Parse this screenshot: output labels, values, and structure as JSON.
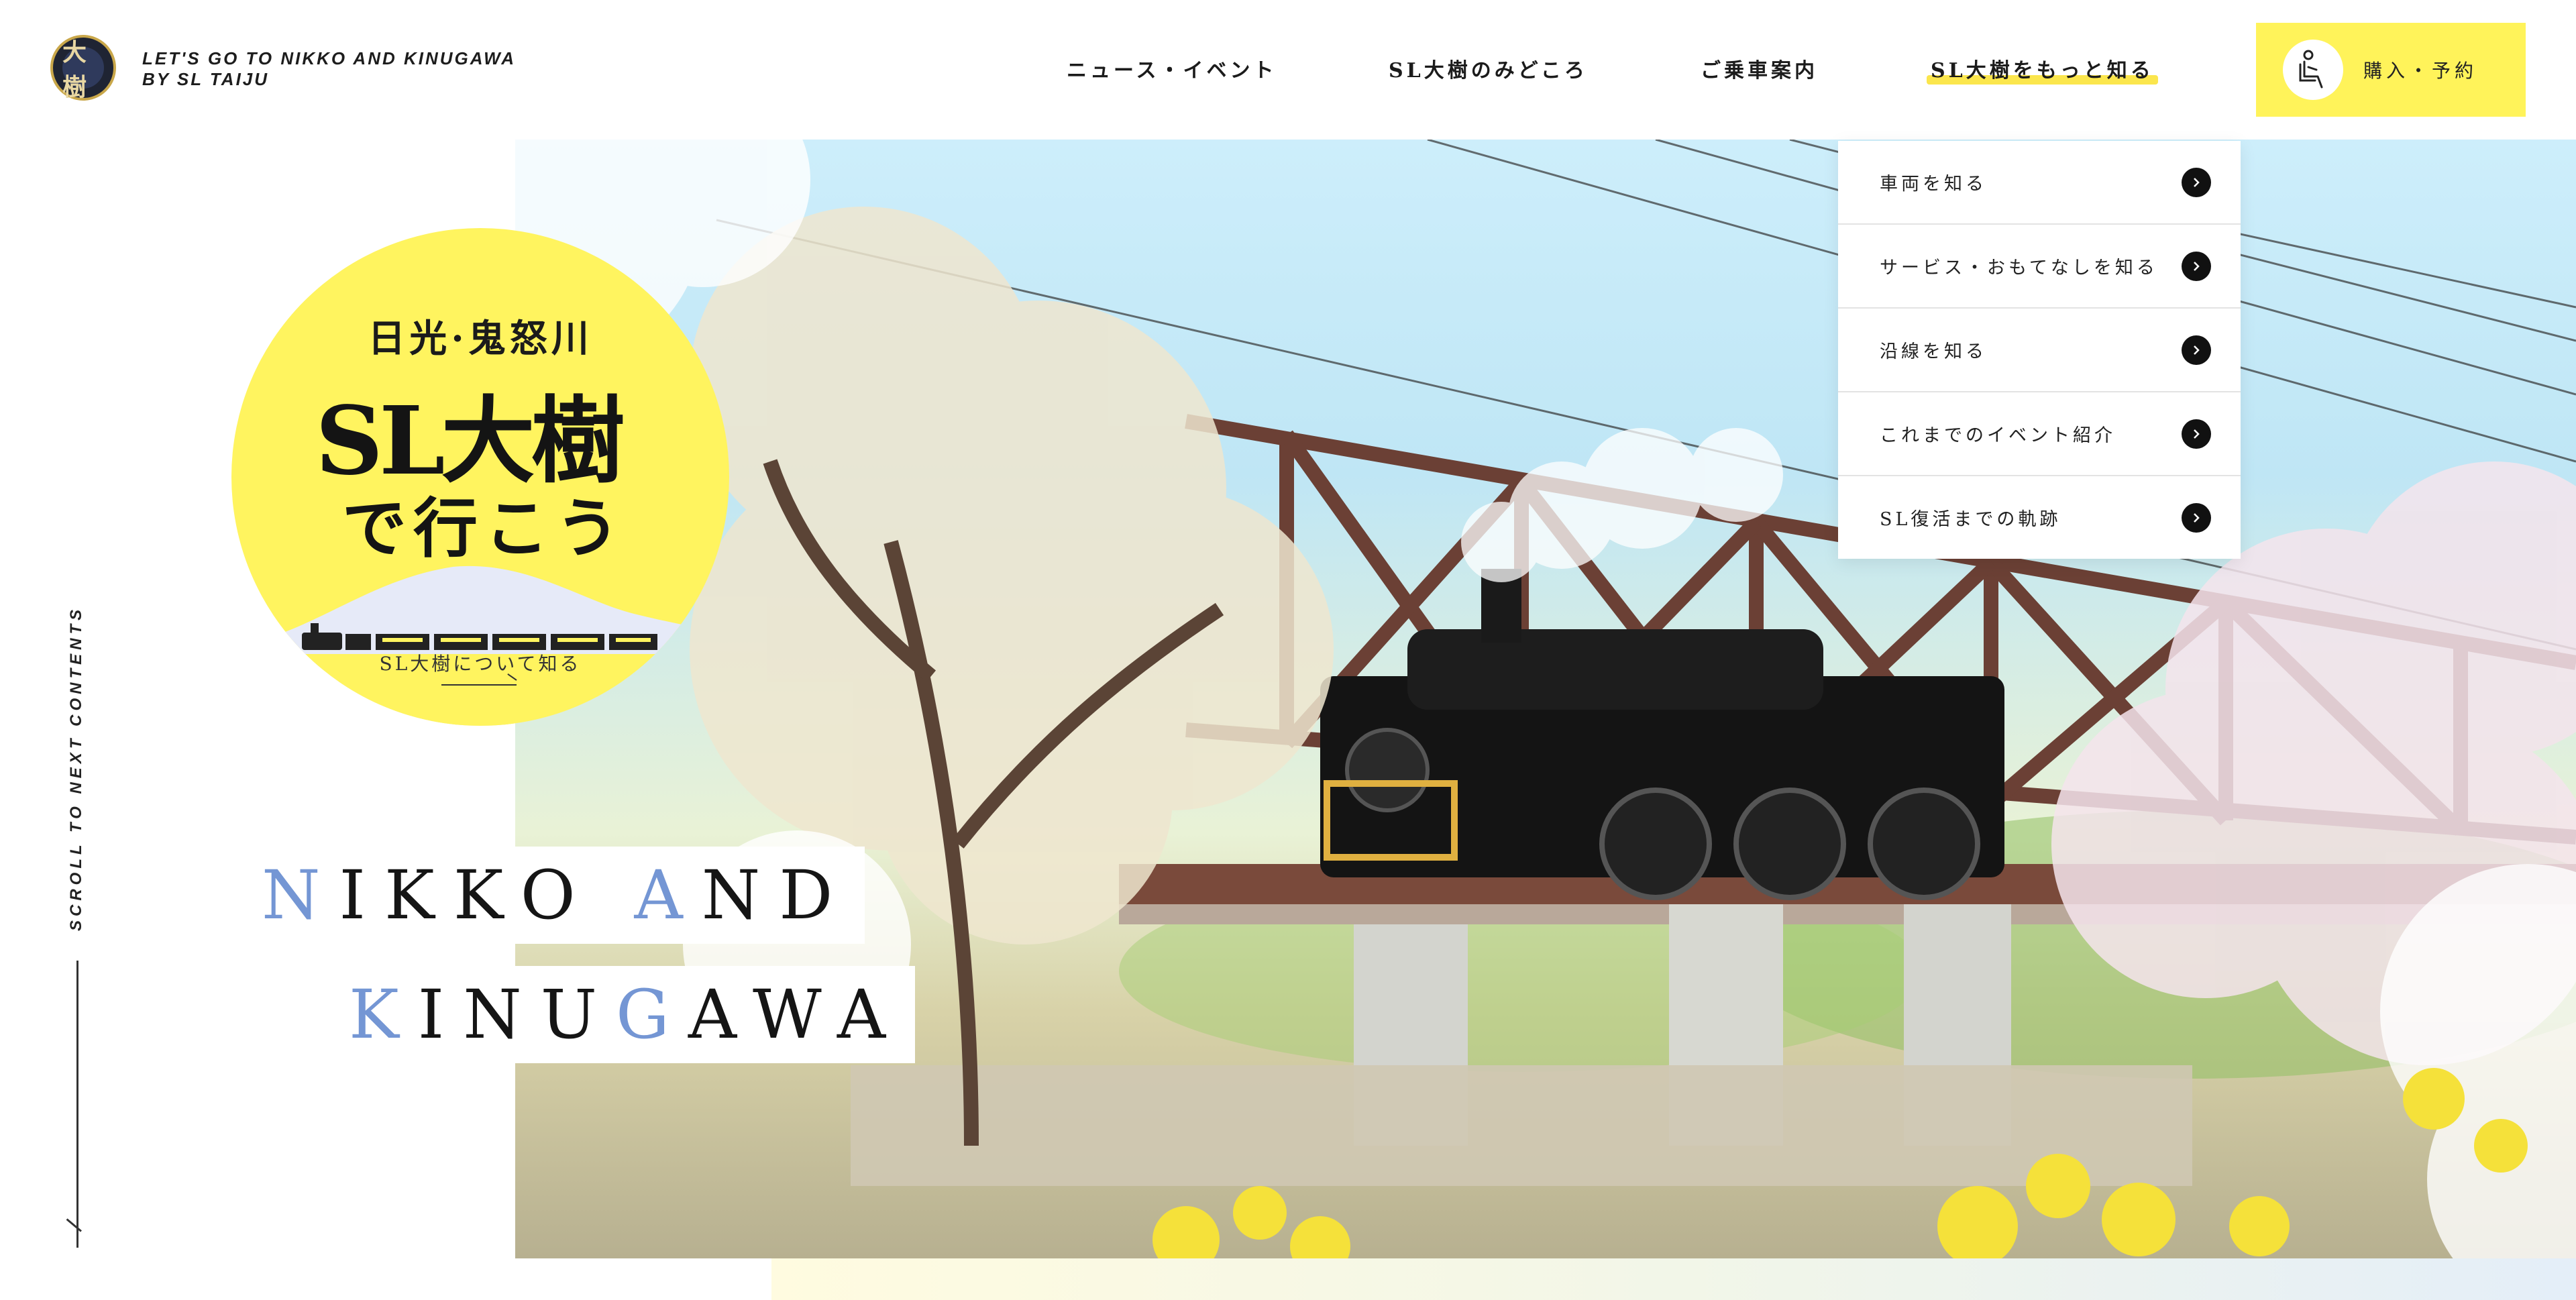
{
  "header": {
    "tagline_line1": "LET'S GO TO NIKKO AND KINUGAWA",
    "tagline_line2": "BY SL TAIJU",
    "logo_text": "大樹"
  },
  "nav": {
    "items": [
      {
        "label": "ニュース・イベント"
      },
      {
        "label": "SL大樹のみどころ"
      },
      {
        "label": "ご乗車案内"
      },
      {
        "label": "SL大樹をもっと知る",
        "active": true
      }
    ],
    "reserve_label": "購入・予約"
  },
  "dropdown": {
    "items": [
      {
        "label": "車両を知る"
      },
      {
        "label": "サービス・おもてなしを知る"
      },
      {
        "label": "沿線を知る"
      },
      {
        "label": "これまでのイベント紹介"
      },
      {
        "label": "SL復活までの軌跡"
      }
    ]
  },
  "badge": {
    "subtitle": "日光·鬼怒川",
    "title": "SL大樹",
    "title2": "で行こう",
    "link_text": "SL大樹について知る"
  },
  "hero": {
    "line1_a": "N",
    "line1_b": "IKKO ",
    "line1_c": "A",
    "line1_d": "ND",
    "line2_a": "K",
    "line2_b": "INU",
    "line2_c": "G",
    "line2_d": "AWA"
  },
  "side": {
    "scroll_text": "SCROLL TO NEXT CONTENTS"
  },
  "colors": {
    "accent_yellow": "#fff35a",
    "title_accent_blue": "#7496d4"
  }
}
